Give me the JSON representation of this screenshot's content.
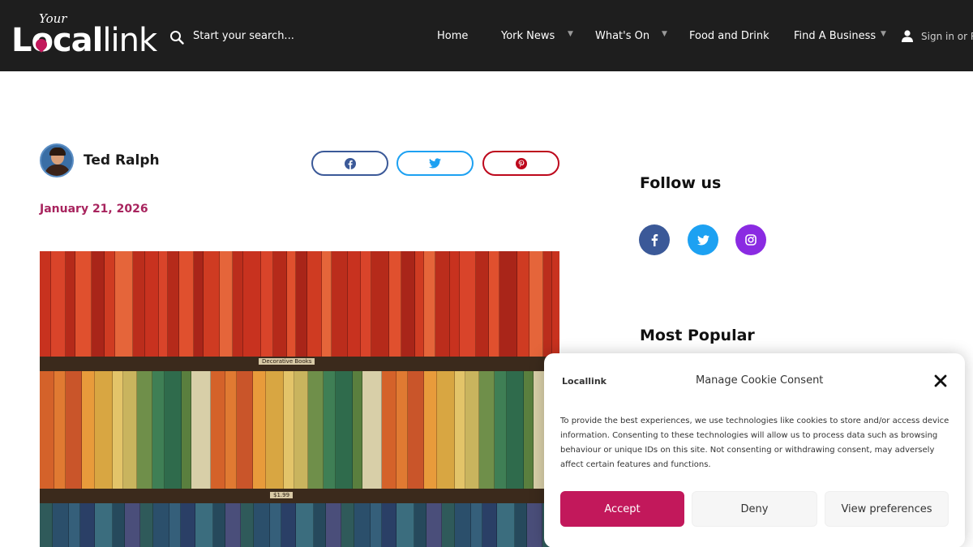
{
  "header": {
    "logo_small": "Your",
    "logo_bold": "Local",
    "logo_thin": "link",
    "search_placeholder": "Start your search...",
    "nav": [
      {
        "label": "Home",
        "has_dropdown": false
      },
      {
        "label": "York News",
        "has_dropdown": true
      },
      {
        "label": "What's On",
        "has_dropdown": true
      },
      {
        "label": "Food and Drink",
        "has_dropdown": false
      },
      {
        "label": "Find A Business",
        "has_dropdown": true
      }
    ],
    "signin_label": "Sign in or R",
    "colors": {
      "background": "#1e1e1e",
      "accent": "#c2185b"
    }
  },
  "article": {
    "author": "Ted Ralph",
    "date": "January 21, 2026",
    "share": [
      {
        "network": "facebook",
        "icon": "facebook-icon",
        "color": "#3b5998"
      },
      {
        "network": "twitter",
        "icon": "twitter-icon",
        "color": "#1da1f2"
      },
      {
        "network": "pinterest",
        "icon": "pinterest-icon",
        "color": "#bd081c"
      }
    ],
    "image": {
      "shelf_labels": [
        "Decorative Books",
        "$1.99"
      ]
    }
  },
  "sidebar": {
    "follow_title": "Follow us",
    "social": [
      {
        "network": "facebook",
        "icon": "facebook-icon",
        "color": "#3b5998"
      },
      {
        "network": "twitter",
        "icon": "twitter-icon",
        "color": "#1da1f2"
      },
      {
        "network": "instagram",
        "icon": "instagram-icon",
        "color": "#8a2be2"
      }
    ],
    "popular_title": "Most Popular"
  },
  "cookie": {
    "logo_text": "Locallink",
    "title": "Manage Cookie Consent",
    "body": "To provide the best experiences, we use technologies like cookies to store and/or access device information. Consenting to these technologies will allow us to process data such as browsing behaviour or unique IDs on this site. Not consenting or withdrawing consent, may adversely affect certain features and functions.",
    "buttons": {
      "accept": "Accept",
      "deny": "Deny",
      "preferences": "View preferences"
    },
    "accent": "#c2185b"
  }
}
